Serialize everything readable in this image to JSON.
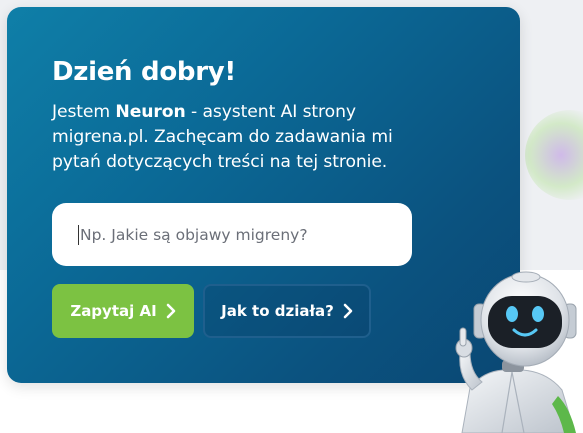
{
  "hero": {
    "title": "Dzień dobry!",
    "intro_prefix": "Jestem ",
    "intro_name": "Neuron",
    "intro_rest": " - asystent AI strony migrena.pl. Zachęcam do zadawania mi pytań dotyczących treści na tej stronie."
  },
  "search": {
    "placeholder": "Np. Jakie są objawy migreny?",
    "value": ""
  },
  "buttons": {
    "ask_label": "Zapytaj AI",
    "how_label": "Jak to działa?"
  },
  "colors": {
    "card_gradient_start": "#0f7fa8",
    "card_gradient_end": "#0a4773",
    "accent_green": "#7cc242",
    "outline_button_border": "#1f5f8d"
  },
  "icons": {
    "button_chevron": "chevron-right-icon",
    "mascot": "robot-mascot"
  }
}
